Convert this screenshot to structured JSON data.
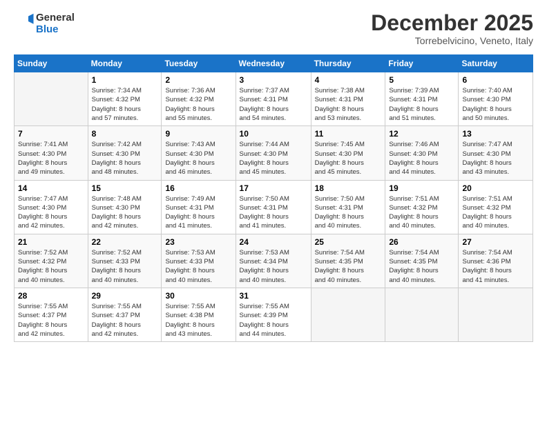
{
  "logo": {
    "line1": "General",
    "line2": "Blue"
  },
  "title": "December 2025",
  "subtitle": "Torrebelvicino, Veneto, Italy",
  "weekdays": [
    "Sunday",
    "Monday",
    "Tuesday",
    "Wednesday",
    "Thursday",
    "Friday",
    "Saturday"
  ],
  "weeks": [
    [
      {
        "day": "",
        "info": ""
      },
      {
        "day": "1",
        "info": "Sunrise: 7:34 AM\nSunset: 4:32 PM\nDaylight: 8 hours\nand 57 minutes."
      },
      {
        "day": "2",
        "info": "Sunrise: 7:36 AM\nSunset: 4:32 PM\nDaylight: 8 hours\nand 55 minutes."
      },
      {
        "day": "3",
        "info": "Sunrise: 7:37 AM\nSunset: 4:31 PM\nDaylight: 8 hours\nand 54 minutes."
      },
      {
        "day": "4",
        "info": "Sunrise: 7:38 AM\nSunset: 4:31 PM\nDaylight: 8 hours\nand 53 minutes."
      },
      {
        "day": "5",
        "info": "Sunrise: 7:39 AM\nSunset: 4:31 PM\nDaylight: 8 hours\nand 51 minutes."
      },
      {
        "day": "6",
        "info": "Sunrise: 7:40 AM\nSunset: 4:30 PM\nDaylight: 8 hours\nand 50 minutes."
      }
    ],
    [
      {
        "day": "7",
        "info": "Sunrise: 7:41 AM\nSunset: 4:30 PM\nDaylight: 8 hours\nand 49 minutes."
      },
      {
        "day": "8",
        "info": "Sunrise: 7:42 AM\nSunset: 4:30 PM\nDaylight: 8 hours\nand 48 minutes."
      },
      {
        "day": "9",
        "info": "Sunrise: 7:43 AM\nSunset: 4:30 PM\nDaylight: 8 hours\nand 46 minutes."
      },
      {
        "day": "10",
        "info": "Sunrise: 7:44 AM\nSunset: 4:30 PM\nDaylight: 8 hours\nand 45 minutes."
      },
      {
        "day": "11",
        "info": "Sunrise: 7:45 AM\nSunset: 4:30 PM\nDaylight: 8 hours\nand 45 minutes."
      },
      {
        "day": "12",
        "info": "Sunrise: 7:46 AM\nSunset: 4:30 PM\nDaylight: 8 hours\nand 44 minutes."
      },
      {
        "day": "13",
        "info": "Sunrise: 7:47 AM\nSunset: 4:30 PM\nDaylight: 8 hours\nand 43 minutes."
      }
    ],
    [
      {
        "day": "14",
        "info": "Sunrise: 7:47 AM\nSunset: 4:30 PM\nDaylight: 8 hours\nand 42 minutes."
      },
      {
        "day": "15",
        "info": "Sunrise: 7:48 AM\nSunset: 4:30 PM\nDaylight: 8 hours\nand 42 minutes."
      },
      {
        "day": "16",
        "info": "Sunrise: 7:49 AM\nSunset: 4:31 PM\nDaylight: 8 hours\nand 41 minutes."
      },
      {
        "day": "17",
        "info": "Sunrise: 7:50 AM\nSunset: 4:31 PM\nDaylight: 8 hours\nand 41 minutes."
      },
      {
        "day": "18",
        "info": "Sunrise: 7:50 AM\nSunset: 4:31 PM\nDaylight: 8 hours\nand 40 minutes."
      },
      {
        "day": "19",
        "info": "Sunrise: 7:51 AM\nSunset: 4:32 PM\nDaylight: 8 hours\nand 40 minutes."
      },
      {
        "day": "20",
        "info": "Sunrise: 7:51 AM\nSunset: 4:32 PM\nDaylight: 8 hours\nand 40 minutes."
      }
    ],
    [
      {
        "day": "21",
        "info": "Sunrise: 7:52 AM\nSunset: 4:32 PM\nDaylight: 8 hours\nand 40 minutes."
      },
      {
        "day": "22",
        "info": "Sunrise: 7:52 AM\nSunset: 4:33 PM\nDaylight: 8 hours\nand 40 minutes."
      },
      {
        "day": "23",
        "info": "Sunrise: 7:53 AM\nSunset: 4:33 PM\nDaylight: 8 hours\nand 40 minutes."
      },
      {
        "day": "24",
        "info": "Sunrise: 7:53 AM\nSunset: 4:34 PM\nDaylight: 8 hours\nand 40 minutes."
      },
      {
        "day": "25",
        "info": "Sunrise: 7:54 AM\nSunset: 4:35 PM\nDaylight: 8 hours\nand 40 minutes."
      },
      {
        "day": "26",
        "info": "Sunrise: 7:54 AM\nSunset: 4:35 PM\nDaylight: 8 hours\nand 40 minutes."
      },
      {
        "day": "27",
        "info": "Sunrise: 7:54 AM\nSunset: 4:36 PM\nDaylight: 8 hours\nand 41 minutes."
      }
    ],
    [
      {
        "day": "28",
        "info": "Sunrise: 7:55 AM\nSunset: 4:37 PM\nDaylight: 8 hours\nand 42 minutes."
      },
      {
        "day": "29",
        "info": "Sunrise: 7:55 AM\nSunset: 4:37 PM\nDaylight: 8 hours\nand 42 minutes."
      },
      {
        "day": "30",
        "info": "Sunrise: 7:55 AM\nSunset: 4:38 PM\nDaylight: 8 hours\nand 43 minutes."
      },
      {
        "day": "31",
        "info": "Sunrise: 7:55 AM\nSunset: 4:39 PM\nDaylight: 8 hours\nand 44 minutes."
      },
      {
        "day": "",
        "info": ""
      },
      {
        "day": "",
        "info": ""
      },
      {
        "day": "",
        "info": ""
      }
    ]
  ]
}
